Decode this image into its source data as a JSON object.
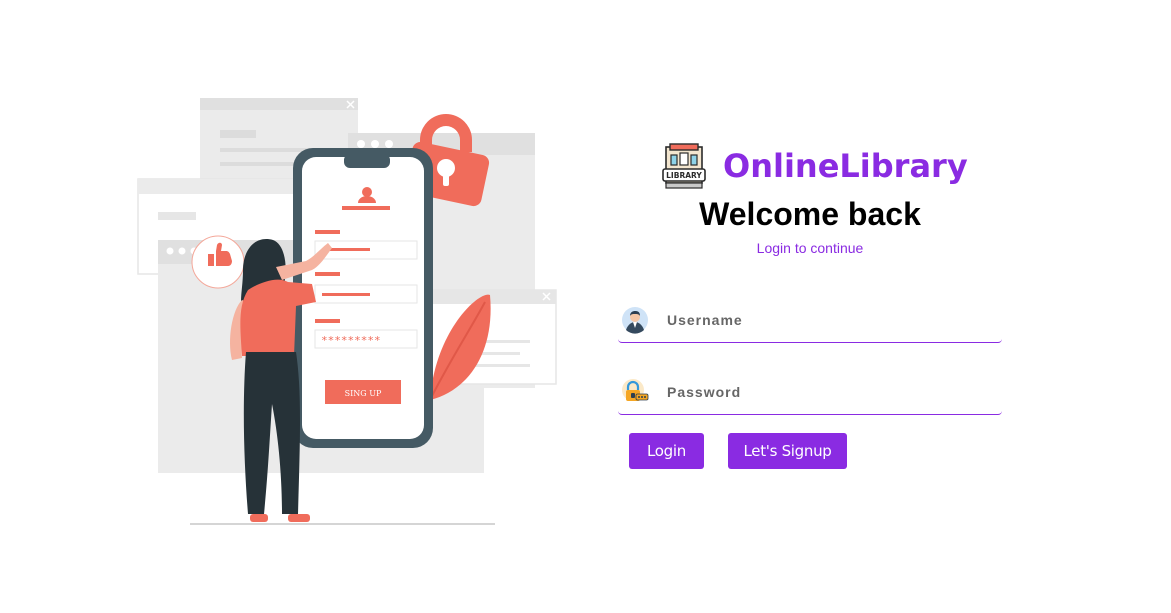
{
  "brand": {
    "logo_icon": "library-building-icon",
    "logo_text": "LIBRARY",
    "name": "OnlineLibrary",
    "accent_color": "#8a2be2"
  },
  "heading": {
    "title": "Welcome back",
    "subtitle": "Login to continue"
  },
  "form": {
    "username": {
      "icon": "user-avatar-icon",
      "placeholder": "Username",
      "value": ""
    },
    "password": {
      "icon": "padlock-key-icon",
      "placeholder": "Password",
      "value": ""
    }
  },
  "buttons": {
    "login_label": "Login",
    "signup_label": "Let's Signup"
  },
  "illustration": {
    "phone_button_label": "SING UP",
    "password_mask": "*********"
  }
}
